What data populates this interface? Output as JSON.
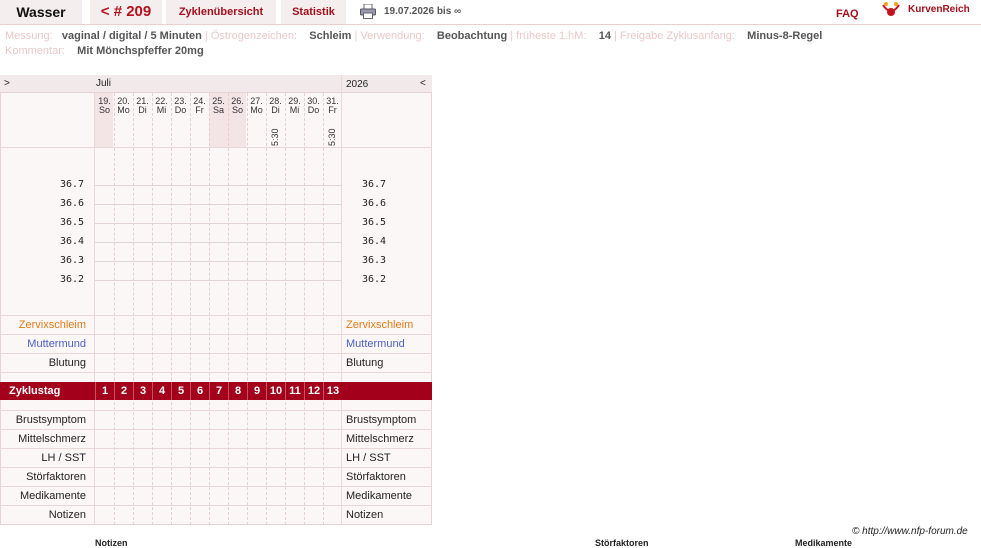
{
  "header": {
    "name": "Wasser",
    "cycle": "< # 209",
    "overview": "Zyklenübersicht",
    "stats": "Statistik",
    "date_range": "19.07.2026 bis ∞",
    "faq": "FAQ",
    "logo": "KurvenReich"
  },
  "info": {
    "messung_label": "Messung:",
    "messung_value": "vaginal / digital / 5 Minuten",
    "oestrogen_label": "Östrogenzeichen:",
    "oestrogen_value": "Schleim",
    "verwendung_label": "Verwendung:",
    "verwendung_value": "Beobachtung",
    "hm_label": "früheste 1.hM:",
    "hm_value": "14",
    "freigabe_label": "Freigabe Zyklusanfang:",
    "freigabe_value": "Minus-8-Regel",
    "kommentar_label": "Kommentar:",
    "kommentar_value": "Mit Mönchspfeffer  20mg"
  },
  "chart": {
    "nav_left": ">",
    "nav_right": "<",
    "month": "Juli",
    "year": "2026",
    "days": [
      {
        "d": "19.",
        "w": "So",
        "t": ""
      },
      {
        "d": "20.",
        "w": "Mo",
        "t": ""
      },
      {
        "d": "21.",
        "w": "Di",
        "t": ""
      },
      {
        "d": "22.",
        "w": "Mi",
        "t": ""
      },
      {
        "d": "23.",
        "w": "Do",
        "t": ""
      },
      {
        "d": "24.",
        "w": "Fr",
        "t": ""
      },
      {
        "d": "25.",
        "w": "Sa",
        "t": ""
      },
      {
        "d": "26.",
        "w": "So",
        "t": ""
      },
      {
        "d": "27.",
        "w": "Mo",
        "t": ""
      },
      {
        "d": "28.",
        "w": "Di",
        "t": "5:30"
      },
      {
        "d": "29.",
        "w": "Mi",
        "t": ""
      },
      {
        "d": "30.",
        "w": "Do",
        "t": ""
      },
      {
        "d": "31.",
        "w": "Fr",
        "t": "5:30"
      }
    ],
    "temps": [
      "36.7",
      "36.6",
      "36.5",
      "36.4",
      "36.3",
      "36.2"
    ],
    "rows_a": {
      "zervix": "Zervixschleim",
      "muttermund": "Muttermund",
      "blutung": "Blutung"
    },
    "zyklustag_label": "Zyklustag",
    "zyklustage": [
      "1",
      "2",
      "3",
      "4",
      "5",
      "6",
      "7",
      "8",
      "9",
      "10",
      "11",
      "12",
      "13"
    ],
    "rows_b": {
      "brust": "Brustsymptom",
      "mittel": "Mittelschmerz",
      "lh": "LH / SST",
      "stoer": "Störfaktoren",
      "medi": "Medikamente",
      "notizen": "Notizen"
    },
    "colors": {
      "accent": "#a3001b",
      "zervix": "#e07a16",
      "muttermund": "#4a5fc1",
      "weekend": "#f3e4e6"
    }
  },
  "footer": {
    "copyright": "© http://www.nfp-forum.de",
    "cut_notizen": "Notizen",
    "cut_stoer": "Störfaktoren",
    "cut_medi": "Medikamente"
  }
}
